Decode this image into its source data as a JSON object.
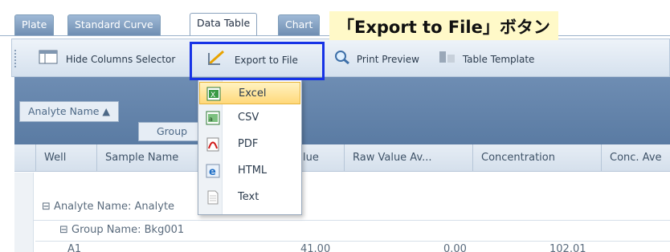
{
  "tabs": [
    {
      "label": "Plate",
      "active": false
    },
    {
      "label": "Standard Curve",
      "active": false
    },
    {
      "label": "Data Table",
      "active": true
    },
    {
      "label": "Chart",
      "active": false
    }
  ],
  "annotation": {
    "text": "「Export to File」ボタン"
  },
  "toolbar": {
    "hide_columns": "Hide Columns Selector",
    "export": "Export to File",
    "print_preview": "Print Preview",
    "table_template": "Table Template"
  },
  "grouping": {
    "chip1": "Analyte Name ▲",
    "chip2": "Group"
  },
  "columns": [
    "Well",
    "Sample Name",
    "lue",
    "Raw Value Av...",
    "Concentration",
    "Conc. Ave"
  ],
  "groups": {
    "analyte_row": "Analyte Name: Analyte",
    "group_row": "Group Name: Bkg001"
  },
  "first_row": {
    "well": "A1",
    "value": "41.00",
    "raw_avg": "0.00",
    "conc": "102.01"
  },
  "export_menu": {
    "items": [
      {
        "label": "Excel",
        "icon": "excel-icon",
        "highlighted": true
      },
      {
        "label": "CSV",
        "icon": "csv-icon",
        "highlighted": false
      },
      {
        "label": "PDF",
        "icon": "pdf-icon",
        "highlighted": false
      },
      {
        "label": "HTML",
        "icon": "html-icon",
        "highlighted": false
      },
      {
        "label": "Text",
        "icon": "text-file-icon",
        "highlighted": false
      }
    ]
  },
  "colors": {
    "annotation_border": "#1733e6",
    "annotation_bg": "#fff9c8",
    "highlight": "#ffd87a",
    "group_band": "#5a7ba3"
  }
}
